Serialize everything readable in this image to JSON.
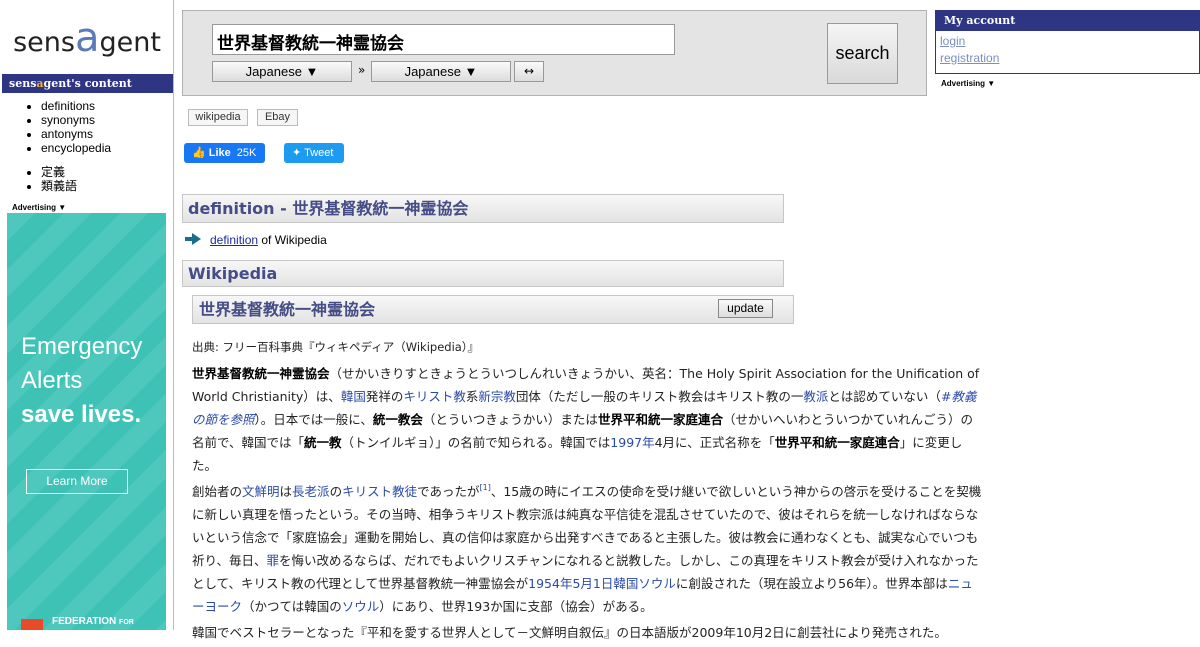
{
  "logo": {
    "prefix": "sens",
    "a": "a",
    "suffix": "gent"
  },
  "left_nav": {
    "header_prefix": "sens",
    "header_a": "a",
    "header_suffix": "gent's content",
    "items_en": [
      "definitions",
      "synonyms",
      "antonyms",
      "encyclopedia"
    ],
    "items_jp": [
      "定義",
      "類義語"
    ],
    "advertising": "Advertising ▼"
  },
  "ad": {
    "line1": "Emergency",
    "line2": "Alerts",
    "line3": "save lives.",
    "button": "Learn More",
    "fed_line1": "FEDERATION",
    "fed_line1_small": "FOR"
  },
  "search": {
    "query": "世界基督教統一神霊協会",
    "from_lang": "Japanese ▼",
    "to_lang": "Japanese ▼",
    "sep": "»",
    "swap": "↔",
    "button": "search"
  },
  "account": {
    "title": "My account",
    "login": "login",
    "registration": "registration",
    "advertising": "Advertising ▼"
  },
  "tags": [
    "wikipedia",
    "Ebay"
  ],
  "social": {
    "like_label": "Like",
    "like_count": "25K",
    "tweet_label": "Tweet"
  },
  "sections": {
    "definition_title": "definition - 世界基督教統一神霊協会",
    "def_link": "definition",
    "def_rest": " of Wikipedia",
    "wikipedia_title": "Wikipedia",
    "term_title": "世界基督教統一神霊協会",
    "update_button": "update"
  },
  "article": {
    "source": "出典: フリー百科事典『ウィキペディア（Wikipedia）』",
    "p1": [
      {
        "t": "世界基督教統一神霊協会",
        "s": "b"
      },
      {
        "t": "（せかいきりすときょうとういつしんれいきょうかい、英名：The Holy Spirit Association for the Unification of World Christianity）は、",
        "s": ""
      },
      {
        "t": "韓国",
        "s": "lnk"
      },
      {
        "t": "発祥の",
        "s": ""
      },
      {
        "t": "キリスト教",
        "s": "lnk"
      },
      {
        "t": "系",
        "s": ""
      },
      {
        "t": "新宗教",
        "s": "lnk"
      },
      {
        "t": "団体（ただし一般のキリスト教会はキリスト教の一",
        "s": ""
      },
      {
        "t": "教派",
        "s": "lnk"
      },
      {
        "t": "とは認めていない（",
        "s": ""
      },
      {
        "t": "#教義の節を参照",
        "s": "lnk-i"
      },
      {
        "t": "）。日本では一般に、",
        "s": ""
      },
      {
        "t": "統一教会",
        "s": "b"
      },
      {
        "t": "（とういつきょうかい）または",
        "s": ""
      },
      {
        "t": "世界平和統一家庭連合",
        "s": "b"
      },
      {
        "t": "（せかいへいわとういつかていれんごう）の名前で、韓国では「",
        "s": ""
      },
      {
        "t": "統一教",
        "s": "b"
      },
      {
        "t": "（トンイルギョ）」の名前で知られる。韓国では",
        "s": ""
      },
      {
        "t": "1997年",
        "s": "lnk"
      },
      {
        "t": "4月に、正式名称を「",
        "s": ""
      },
      {
        "t": "世界平和統一家庭連合",
        "s": "b"
      },
      {
        "t": "」に変更した。",
        "s": ""
      }
    ],
    "p2": [
      {
        "t": "創始者の",
        "s": ""
      },
      {
        "t": "文鮮明",
        "s": "lnk"
      },
      {
        "t": "は",
        "s": ""
      },
      {
        "t": "長老派",
        "s": "lnk"
      },
      {
        "t": "の",
        "s": ""
      },
      {
        "t": "キリスト教徒",
        "s": "lnk"
      },
      {
        "t": "であったが",
        "s": ""
      },
      {
        "t": "[1]",
        "s": "sup"
      },
      {
        "t": "、15歳の時にイエスの使命を受け継いで欲しいという神からの啓示を受けることを契機に新しい真理を悟ったという。その当時、相争うキリスト教宗派は純真な平信徒を混乱させていたので、彼はそれらを統一しなければならないという信念で「家庭協会」運動を開始し、真の信仰は家庭から出発すべきであると主張した。彼は教会に通わなくとも、誠実な心でいつも祈り、毎日、",
        "s": ""
      },
      {
        "t": "罪",
        "s": "lnk"
      },
      {
        "t": "を悔い改めるならば、だれでもよいクリスチャンになれると説教した。しかし、この真理をキリスト教会が受け入れなかったとして、キリスト教の代理として世界基督教統一神霊協会が",
        "s": ""
      },
      {
        "t": "1954年",
        "s": "lnk"
      },
      {
        "t": "5月1日",
        "s": "lnk"
      },
      {
        "t": "韓国",
        "s": "lnk"
      },
      {
        "t": "ソウル",
        "s": "lnk"
      },
      {
        "t": "に創設された（現在設立より56年）。世界本部は",
        "s": ""
      },
      {
        "t": "ニューヨーク",
        "s": "lnk"
      },
      {
        "t": "（かつては韓国の",
        "s": ""
      },
      {
        "t": "ソウル",
        "s": "lnk"
      },
      {
        "t": "）にあり、世界193か国に支部（協会）がある。",
        "s": ""
      }
    ],
    "p3": [
      {
        "t": "韓国でベストセラーとなった『平和を愛する世界人として－文鮮明自叙伝』の日本語版が2009年10月2日に創芸社により発売された。",
        "s": ""
      }
    ]
  }
}
